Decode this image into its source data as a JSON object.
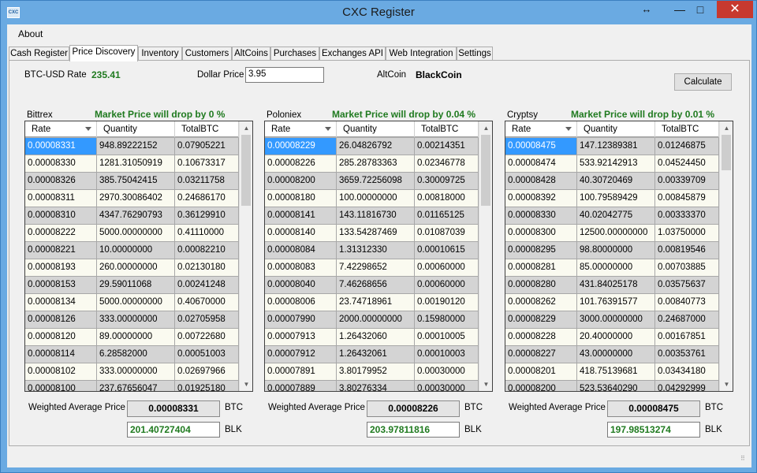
{
  "window": {
    "title": "CXC Register",
    "icon_text": "CXC"
  },
  "menu": {
    "about": "About"
  },
  "tabs": [
    "Cash Register",
    "Price Discovery",
    "Inventory",
    "Customers",
    "AltCoins",
    "Purchases",
    "Exchanges API",
    "Web Integration",
    "Settings"
  ],
  "top": {
    "btc_usd_label": "BTC-USD Rate",
    "btc_usd_value": "235.41",
    "dollar_price_label": "Dollar Price",
    "dollar_price_value": "3.95",
    "altcoin_label": "AltCoin",
    "altcoin_value": "BlackCoin",
    "calculate_label": "Calculate"
  },
  "columns": [
    "Rate",
    "Quantity",
    "TotalBTC"
  ],
  "labels": {
    "weighted_avg": "Weighted Average Price",
    "btc_unit": "BTC",
    "blk_unit": "BLK"
  },
  "exchanges": [
    {
      "name": "Bittrex",
      "drop_msg": "Market Price will drop by 0 %",
      "weighted_avg": "0.00008331",
      "blk_value": "201.40727404",
      "rows": [
        [
          "0.00008331",
          "948.89222152",
          "0.07905221"
        ],
        [
          "0.00008330",
          "1281.31050919",
          "0.10673317"
        ],
        [
          "0.00008326",
          "385.75042415",
          "0.03211758"
        ],
        [
          "0.00008311",
          "2970.30086402",
          "0.24686170"
        ],
        [
          "0.00008310",
          "4347.76290793",
          "0.36129910"
        ],
        [
          "0.00008222",
          "5000.00000000",
          "0.41110000"
        ],
        [
          "0.00008221",
          "10.00000000",
          "0.00082210"
        ],
        [
          "0.00008193",
          "260.00000000",
          "0.02130180"
        ],
        [
          "0.00008153",
          "29.59011068",
          "0.00241248"
        ],
        [
          "0.00008134",
          "5000.00000000",
          "0.40670000"
        ],
        [
          "0.00008126",
          "333.00000000",
          "0.02705958"
        ],
        [
          "0.00008120",
          "89.00000000",
          "0.00722680"
        ],
        [
          "0.00008114",
          "6.28582000",
          "0.00051003"
        ],
        [
          "0.00008102",
          "333.00000000",
          "0.02697966"
        ],
        [
          "0.00008100",
          "237.67656047",
          "0.01925180"
        ]
      ]
    },
    {
      "name": "Poloniex",
      "drop_msg": "Market Price will drop by 0.04 %",
      "weighted_avg": "0.00008226",
      "blk_value": "203.97811816",
      "rows": [
        [
          "0.00008229",
          "26.04826792",
          "0.00214351"
        ],
        [
          "0.00008226",
          "285.28783363",
          "0.02346778"
        ],
        [
          "0.00008200",
          "3659.72256098",
          "0.30009725"
        ],
        [
          "0.00008180",
          "100.00000000",
          "0.00818000"
        ],
        [
          "0.00008141",
          "143.11816730",
          "0.01165125"
        ],
        [
          "0.00008140",
          "133.54287469",
          "0.01087039"
        ],
        [
          "0.00008084",
          "1.31312330",
          "0.00010615"
        ],
        [
          "0.00008083",
          "7.42298652",
          "0.00060000"
        ],
        [
          "0.00008040",
          "7.46268656",
          "0.00060000"
        ],
        [
          "0.00008006",
          "23.74718961",
          "0.00190120"
        ],
        [
          "0.00007990",
          "2000.00000000",
          "0.15980000"
        ],
        [
          "0.00007913",
          "1.26432060",
          "0.00010005"
        ],
        [
          "0.00007912",
          "1.26432061",
          "0.00010003"
        ],
        [
          "0.00007891",
          "3.80179952",
          "0.00030000"
        ],
        [
          "0.00007889",
          "3.80276334",
          "0.00030000"
        ]
      ]
    },
    {
      "name": "Cryptsy",
      "drop_msg": "Market Price will drop by 0.01 %",
      "weighted_avg": "0.00008475",
      "blk_value": "197.98513274",
      "rows": [
        [
          "0.00008475",
          "147.12389381",
          "0.01246875"
        ],
        [
          "0.00008474",
          "533.92142913",
          "0.04524450"
        ],
        [
          "0.00008428",
          "40.30720469",
          "0.00339709"
        ],
        [
          "0.00008392",
          "100.79589429",
          "0.00845879"
        ],
        [
          "0.00008330",
          "40.02042775",
          "0.00333370"
        ],
        [
          "0.00008300",
          "12500.00000000",
          "1.03750000"
        ],
        [
          "0.00008295",
          "98.80000000",
          "0.00819546"
        ],
        [
          "0.00008281",
          "85.00000000",
          "0.00703885"
        ],
        [
          "0.00008280",
          "431.84025178",
          "0.03575637"
        ],
        [
          "0.00008262",
          "101.76391577",
          "0.00840773"
        ],
        [
          "0.00008229",
          "3000.00000000",
          "0.24687000"
        ],
        [
          "0.00008228",
          "20.40000000",
          "0.00167851"
        ],
        [
          "0.00008227",
          "43.00000000",
          "0.00353761"
        ],
        [
          "0.00008201",
          "418.75139681",
          "0.03434180"
        ],
        [
          "0.00008200",
          "523.53640290",
          "0.04292999"
        ]
      ]
    }
  ]
}
